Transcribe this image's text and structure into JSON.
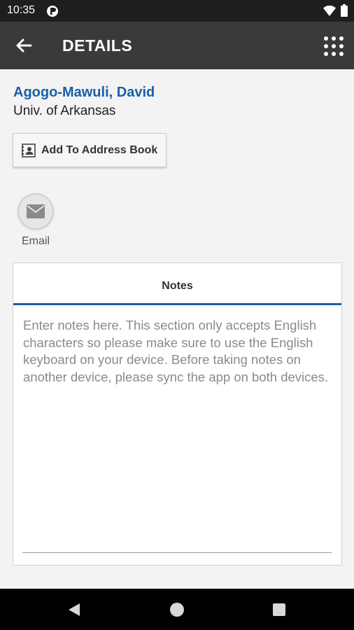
{
  "status_bar": {
    "time": "10:35"
  },
  "app_bar": {
    "title": "DETAILS"
  },
  "contact": {
    "name": "Agogo-Mawuli, David",
    "organization": "Univ. of Arkansas"
  },
  "actions": {
    "add_to_address_book": "Add To Address Book",
    "email_label": "Email"
  },
  "notes": {
    "tab_label": "Notes",
    "placeholder": "Enter notes here. This section only accepts English characters so please make sure to use the English keyboard on your device. Before taking notes on another device, please sync the app on both devices."
  },
  "colors": {
    "accent": "#1a5fa8",
    "app_bar": "#3a3a3a",
    "status_bar": "#1e1e1e"
  }
}
